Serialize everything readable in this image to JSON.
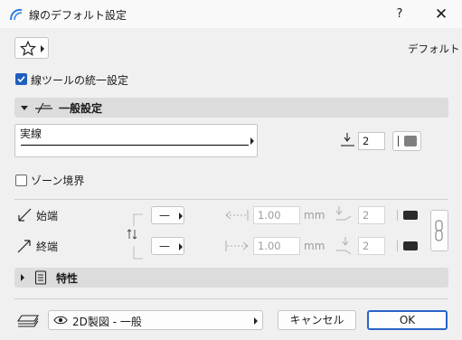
{
  "window": {
    "title": "線のデフォルト設定",
    "help_label": "?",
    "close_label": "✕"
  },
  "toolbar": {
    "favorites_icon": "star-icon",
    "default_label": "デフォルト"
  },
  "unify_setting": {
    "label": "線ツールの統一設定",
    "checked": true
  },
  "general_section": {
    "label": "一般設定",
    "expanded": true
  },
  "line_type": {
    "name": "実線"
  },
  "pen": {
    "number": "2",
    "color": "#808080"
  },
  "zone_boundary": {
    "label": "ゾーン境界",
    "checked": false
  },
  "start": {
    "label": "始端",
    "marker": "—",
    "size": "1.00",
    "unit": "mm",
    "pen": "2"
  },
  "end": {
    "label": "終端",
    "marker": "—",
    "size": "1.00",
    "unit": "mm",
    "pen": "2"
  },
  "properties_section": {
    "label": "特性",
    "expanded": false
  },
  "footer": {
    "layer_combo": "2D製図 - 一般",
    "cancel_label": "キャンセル",
    "ok_label": "OK"
  },
  "colors": {
    "accent": "#1e5fbf",
    "section_bg": "#dcdcdc",
    "window_bg": "#f0f0f0"
  }
}
